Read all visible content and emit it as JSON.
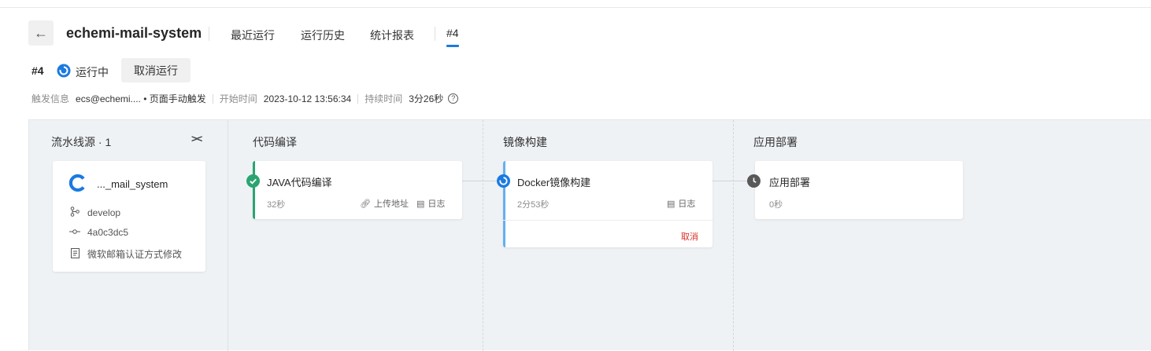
{
  "header": {
    "back_icon": "arrow-left-icon",
    "project_name": "echemi-mail-system",
    "tabs": [
      {
        "label": "最近运行"
      },
      {
        "label": "运行历史"
      },
      {
        "label": "统计报表"
      },
      {
        "label": "#4",
        "active": true
      }
    ]
  },
  "run": {
    "number": "#4",
    "status": "运行中",
    "status_color": "#1b7ae0",
    "cancel_label": "取消运行",
    "meta": {
      "trigger_label": "触发信息",
      "trigger_value": "ecs@echemi.... • 页面手动触发",
      "start_label": "开始时间",
      "start_value": "2023-10-12 13:56:34",
      "duration_label": "持续时间",
      "duration_value": "3分26秒"
    }
  },
  "pipeline": {
    "source": {
      "title": "流水线源 · 1",
      "repo_name": "..._mail_system",
      "branch": "develop",
      "commit": "4a0c3dc5",
      "message": "微软邮箱认证方式修改"
    },
    "stages": [
      {
        "title": "代码编译",
        "job": {
          "name": "JAVA代码编译",
          "time": "32秒",
          "status": "success",
          "color": "#2ba471",
          "actions": [
            {
              "label": "上传地址",
              "icon": "link-icon"
            },
            {
              "label": "日志",
              "icon": "log-icon"
            }
          ]
        }
      },
      {
        "title": "镜像构建",
        "job": {
          "name": "Docker镜像构建",
          "time": "2分53秒",
          "status": "running",
          "color": "#1b7ae0",
          "actions": [
            {
              "label": "日志",
              "icon": "log-icon"
            }
          ],
          "cancel_label": "取消"
        }
      },
      {
        "title": "应用部署",
        "job": {
          "name": "应用部署",
          "time": "0秒",
          "status": "waiting",
          "color": "#595959",
          "actions": []
        }
      }
    ]
  }
}
